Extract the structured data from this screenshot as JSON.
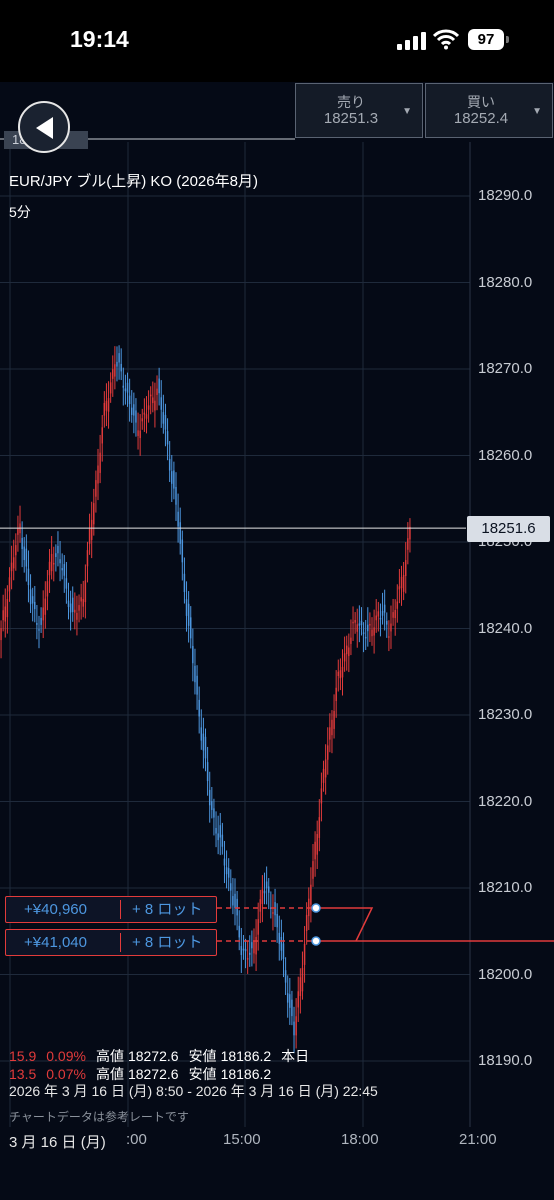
{
  "status_bar": {
    "time": "19:14",
    "battery": "97"
  },
  "header": {
    "sell": {
      "label": "売り",
      "value": "18251.3"
    },
    "buy": {
      "label": "買い",
      "value": "18252.4"
    },
    "price_tag": "18251.5"
  },
  "chart": {
    "title": "EUR/JPY ブル(上昇) KO (2026年8月)",
    "timeframe": "5分",
    "current_price": "18251.6",
    "positions": [
      {
        "amount": "+¥40,960",
        "lots": "+ 8 ロット"
      },
      {
        "amount": "+¥41,040",
        "lots": "+ 8 ロット"
      }
    ]
  },
  "stats": {
    "line1": {
      "change": "15.9",
      "pct": "0.09%",
      "high_label": "高値",
      "high": "18272.6",
      "low_label": "安値",
      "low": "18186.2",
      "suffix": "本日"
    },
    "line2": {
      "change": "13.5",
      "pct": "0.07%",
      "high_label": "高値",
      "high": "18272.6",
      "low_label": "安値",
      "low": "18186.2"
    },
    "period": "2026 年 3 月 16 日 (月) 8:50 - 2026 年 3 月 16 日 (月) 22:45",
    "note": "チャートデータは参考レートです"
  },
  "x_axis": {
    "date_label": "3 月 16 日 (月)",
    "ticks": [
      ":00",
      "15:00",
      "18:00",
      "21:00"
    ]
  },
  "colors": {
    "up": "#e23b3b",
    "down": "#4d97e0",
    "background": "#050a16",
    "grid": "#1f2a3b"
  },
  "chart_data": {
    "type": "line",
    "title": "EUR/JPY ブル(上昇) KO (2026年8月)",
    "xlabel": "",
    "ylabel": "",
    "y_ticks": [
      18190.0,
      18200.0,
      18210.0,
      18220.0,
      18230.0,
      18240.0,
      18250.0,
      18260.0,
      18270.0,
      18280.0,
      18290.0
    ],
    "ylim": [
      18184,
      18294
    ],
    "x_ticks": [
      ":00",
      "15:00",
      "18:00",
      "21:00"
    ],
    "series": [
      {
        "values": [
          18238,
          18246,
          18252,
          18243,
          18240,
          18249,
          18247,
          18241,
          18244,
          18255,
          18265,
          18271,
          18268,
          18263,
          18265,
          18268,
          18261,
          18252,
          18240,
          18230,
          18220,
          18215,
          18210,
          18203,
          18202,
          18210,
          18208,
          18201,
          18193,
          18204,
          18215,
          18225,
          18233,
          18238,
          18241,
          18239,
          18242,
          18240,
          18244,
          18251.6
        ]
      }
    ],
    "horizontal_lines": [
      {
        "value": 18251.6
      },
      {
        "value": 18204.1
      }
    ]
  }
}
